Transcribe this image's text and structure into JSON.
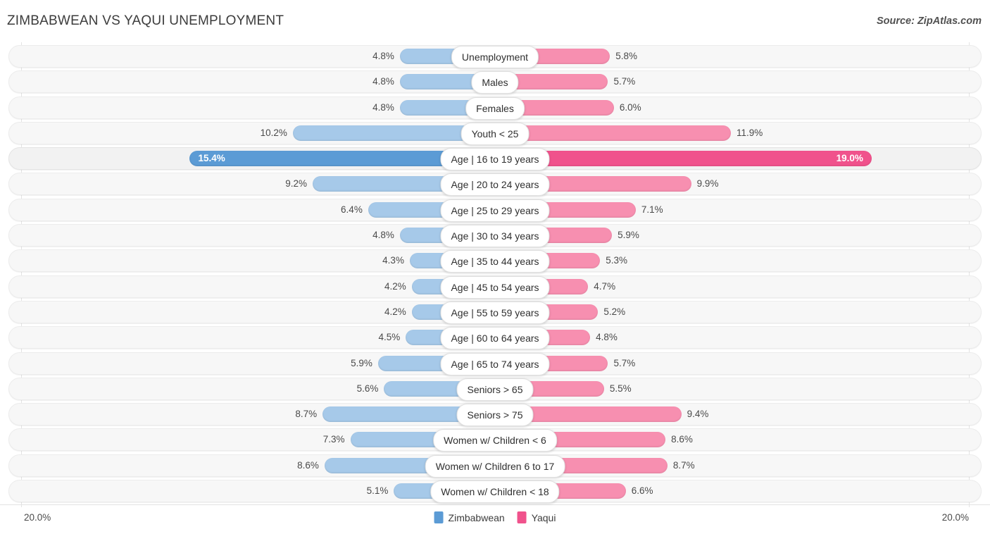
{
  "header": {
    "title": "ZIMBABWEAN VS YAQUI UNEMPLOYMENT",
    "source": "Source: ZipAtlas.com"
  },
  "axis": {
    "left_label": "20.0%",
    "right_label": "20.0%",
    "max": 20.0
  },
  "legend": {
    "items": [
      {
        "label": "Zimbabwean",
        "color": "#5b9bd5"
      },
      {
        "label": "Yaqui",
        "color": "#f0528c"
      }
    ]
  },
  "colors": {
    "left_bar": "#a6c9e9",
    "right_bar": "#f78fb0",
    "left_bar_highlight": "#5b9bd5",
    "right_bar_highlight": "#f0528c",
    "track": "#f7f7f7",
    "gridline": "#e3e3e3"
  },
  "chart_data": {
    "type": "bar",
    "title": "ZIMBABWEAN VS YAQUI UNEMPLOYMENT",
    "subtitle": "",
    "xlabel": "",
    "ylabel": "",
    "orientation": "horizontal-diverging",
    "xlim": [
      0,
      20.0
    ],
    "grid": true,
    "legend_position": "bottom-center",
    "categories": [
      "Unemployment",
      "Males",
      "Females",
      "Youth < 25",
      "Age | 16 to 19 years",
      "Age | 20 to 24 years",
      "Age | 25 to 29 years",
      "Age | 30 to 34 years",
      "Age | 35 to 44 years",
      "Age | 45 to 54 years",
      "Age | 55 to 59 years",
      "Age | 60 to 64 years",
      "Age | 65 to 74 years",
      "Seniors > 65",
      "Seniors > 75",
      "Women w/ Children < 6",
      "Women w/ Children 6 to 17",
      "Women w/ Children < 18"
    ],
    "series": [
      {
        "name": "Zimbabwean",
        "color": "#5b9bd5",
        "values": [
          4.8,
          4.8,
          4.8,
          10.2,
          15.4,
          9.2,
          6.4,
          4.8,
          4.3,
          4.2,
          4.2,
          4.5,
          5.9,
          5.6,
          8.7,
          7.3,
          8.6,
          5.1
        ],
        "labels": [
          "4.8%",
          "4.8%",
          "4.8%",
          "10.2%",
          "15.4%",
          "9.2%",
          "6.4%",
          "4.8%",
          "4.3%",
          "4.2%",
          "4.2%",
          "4.5%",
          "5.9%",
          "5.6%",
          "8.7%",
          "7.3%",
          "8.6%",
          "5.1%"
        ]
      },
      {
        "name": "Yaqui",
        "color": "#f0528c",
        "values": [
          5.8,
          5.7,
          6.0,
          11.9,
          19.0,
          9.9,
          7.1,
          5.9,
          5.3,
          4.7,
          5.2,
          4.8,
          5.7,
          5.5,
          9.4,
          8.6,
          8.7,
          6.6
        ],
        "labels": [
          "5.8%",
          "5.7%",
          "6.0%",
          "11.9%",
          "19.0%",
          "9.9%",
          "7.1%",
          "5.9%",
          "5.3%",
          "4.7%",
          "5.2%",
          "4.8%",
          "5.7%",
          "5.5%",
          "9.4%",
          "8.6%",
          "8.7%",
          "6.6%"
        ]
      }
    ],
    "highlighted_category": "Age | 16 to 19 years"
  },
  "rows": [
    {
      "label": "Unemployment",
      "left_value": 4.8,
      "left_label": "4.8%",
      "right_value": 5.8,
      "right_label": "5.8%",
      "highlight": false
    },
    {
      "label": "Males",
      "left_value": 4.8,
      "left_label": "4.8%",
      "right_value": 5.7,
      "right_label": "5.7%",
      "highlight": false
    },
    {
      "label": "Females",
      "left_value": 4.8,
      "left_label": "4.8%",
      "right_value": 6.0,
      "right_label": "6.0%",
      "highlight": false
    },
    {
      "label": "Youth < 25",
      "left_value": 10.2,
      "left_label": "10.2%",
      "right_value": 11.9,
      "right_label": "11.9%",
      "highlight": false
    },
    {
      "label": "Age | 16 to 19 years",
      "left_value": 15.4,
      "left_label": "15.4%",
      "right_value": 19.0,
      "right_label": "19.0%",
      "highlight": true
    },
    {
      "label": "Age | 20 to 24 years",
      "left_value": 9.2,
      "left_label": "9.2%",
      "right_value": 9.9,
      "right_label": "9.9%",
      "highlight": false
    },
    {
      "label": "Age | 25 to 29 years",
      "left_value": 6.4,
      "left_label": "6.4%",
      "right_value": 7.1,
      "right_label": "7.1%",
      "highlight": false
    },
    {
      "label": "Age | 30 to 34 years",
      "left_value": 4.8,
      "left_label": "4.8%",
      "right_value": 5.9,
      "right_label": "5.9%",
      "highlight": false
    },
    {
      "label": "Age | 35 to 44 years",
      "left_value": 4.3,
      "left_label": "4.3%",
      "right_value": 5.3,
      "right_label": "5.3%",
      "highlight": false
    },
    {
      "label": "Age | 45 to 54 years",
      "left_value": 4.2,
      "left_label": "4.2%",
      "right_value": 4.7,
      "right_label": "4.7%",
      "highlight": false
    },
    {
      "label": "Age | 55 to 59 years",
      "left_value": 4.2,
      "left_label": "4.2%",
      "right_value": 5.2,
      "right_label": "5.2%",
      "highlight": false
    },
    {
      "label": "Age | 60 to 64 years",
      "left_value": 4.5,
      "left_label": "4.5%",
      "right_value": 4.8,
      "right_label": "4.8%",
      "highlight": false
    },
    {
      "label": "Age | 65 to 74 years",
      "left_value": 5.9,
      "left_label": "5.9%",
      "right_value": 5.7,
      "right_label": "5.7%",
      "highlight": false
    },
    {
      "label": "Seniors > 65",
      "left_value": 5.6,
      "left_label": "5.6%",
      "right_value": 5.5,
      "right_label": "5.5%",
      "highlight": false
    },
    {
      "label": "Seniors > 75",
      "left_value": 8.7,
      "left_label": "8.7%",
      "right_value": 9.4,
      "right_label": "9.4%",
      "highlight": false
    },
    {
      "label": "Women w/ Children < 6",
      "left_value": 7.3,
      "left_label": "7.3%",
      "right_value": 8.6,
      "right_label": "8.6%",
      "highlight": false
    },
    {
      "label": "Women w/ Children 6 to 17",
      "left_value": 8.6,
      "left_label": "8.6%",
      "right_value": 8.7,
      "right_label": "8.7%",
      "highlight": false
    },
    {
      "label": "Women w/ Children < 18",
      "left_value": 5.1,
      "left_label": "5.1%",
      "right_value": 6.6,
      "right_label": "6.6%",
      "highlight": false
    }
  ]
}
